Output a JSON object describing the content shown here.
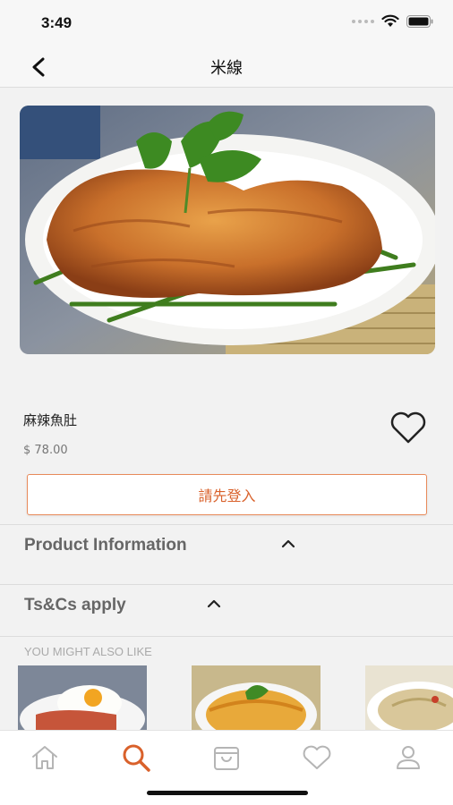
{
  "status_bar": {
    "time": "3:49"
  },
  "nav": {
    "title": "米線"
  },
  "product": {
    "name": "麻辣魚肚",
    "price": "$ 78.00"
  },
  "login_button": {
    "label": "請先登入"
  },
  "sections": {
    "product_information": "Product Information",
    "terms": "Ts&Cs apply"
  },
  "recommendations": {
    "heading": "YOU MIGHT ALSO LIKE"
  },
  "tabs": [
    {
      "icon": "home-icon",
      "active": false
    },
    {
      "icon": "search-icon",
      "active": true
    },
    {
      "icon": "shopping-bag-icon",
      "active": false
    },
    {
      "icon": "heart-icon",
      "active": false
    },
    {
      "icon": "profile-icon",
      "active": false
    }
  ],
  "colors": {
    "accent": "#d9612b",
    "inactive_tab": "#b5b5b5"
  }
}
